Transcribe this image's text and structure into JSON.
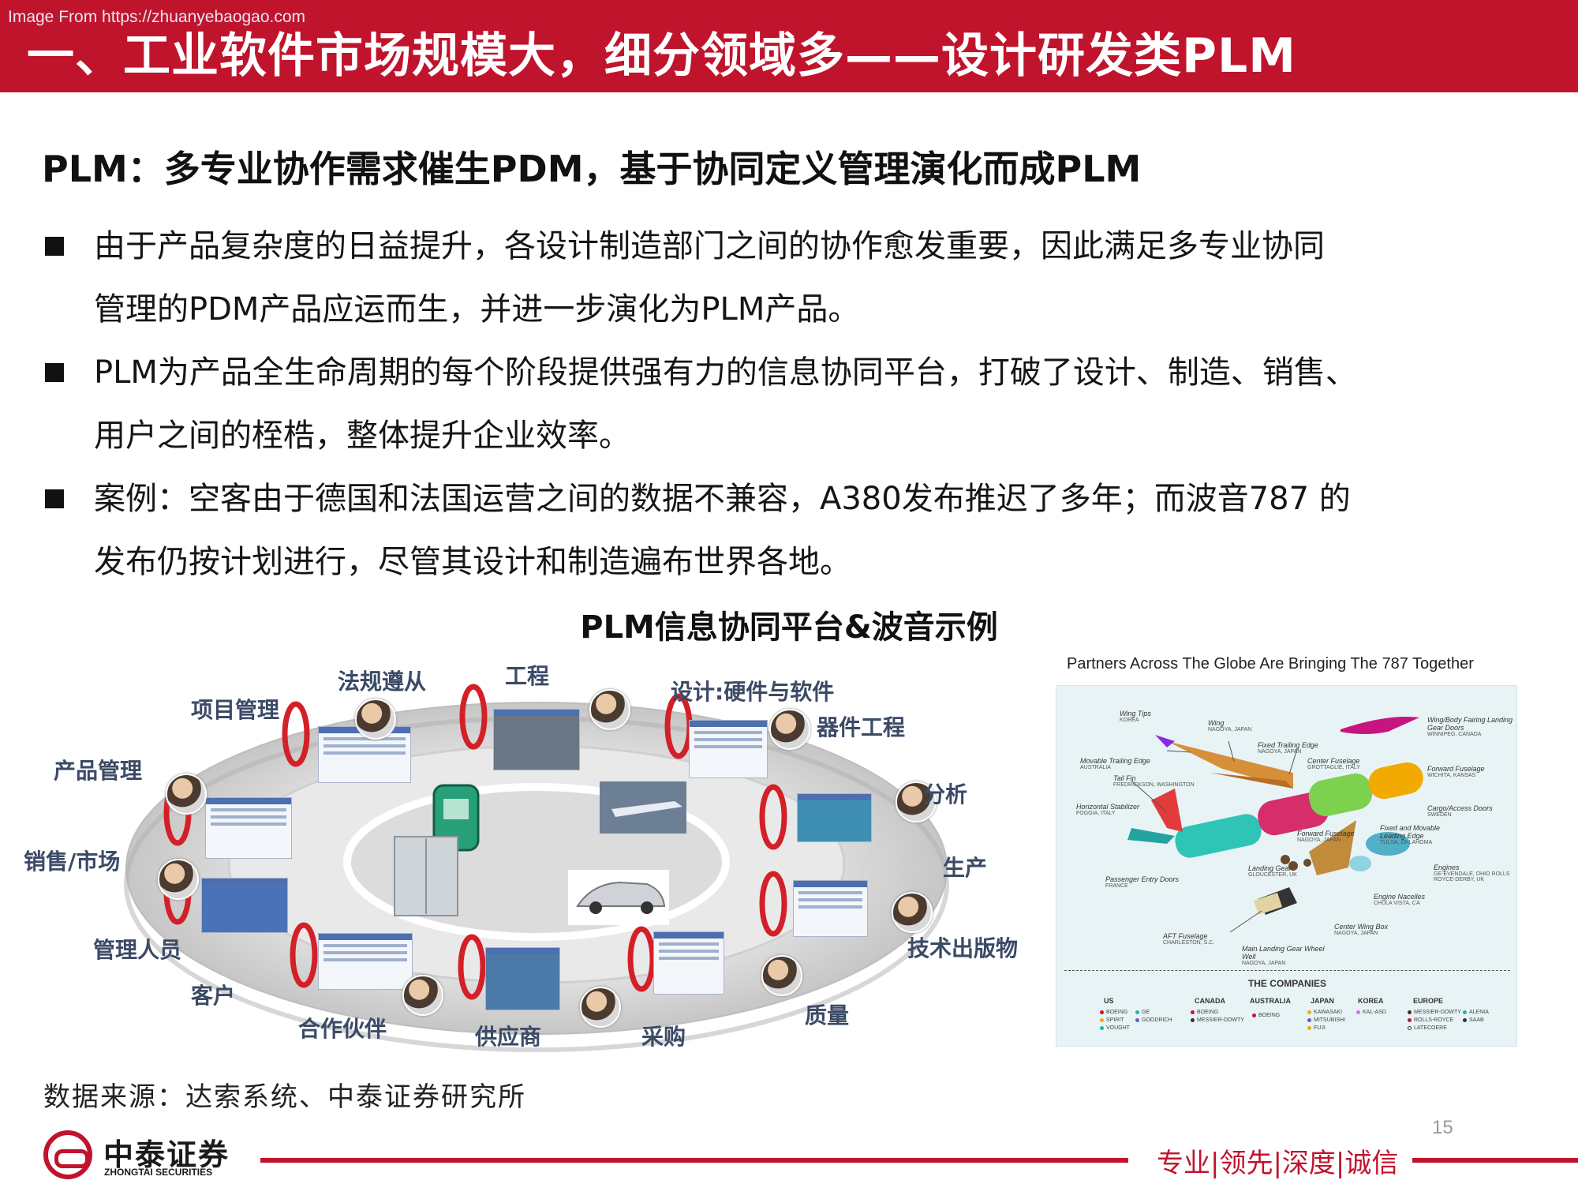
{
  "watermark": "Image From https://zhuanyebaogao.com",
  "title": "一、工业软件市场规模大，细分领域多——设计研发类PLM",
  "subtitle": "PLM：多专业协作需求催生PDM，基于协同定义管理演化而成PLM",
  "bullets": [
    {
      "line1": "由于产品复杂度的日益提升，各设计制造部门之间的协作愈发重要，因此满足多专业协同",
      "line2": "管理的PDM产品应运而生，并进一步演化为PLM产品。"
    },
    {
      "line1": "PLM为产品全生命周期的每个阶段提供强有力的信息协同平台，打破了设计、制造、销售、",
      "line2": "用户之间的桎梏，整体提升企业效率。"
    },
    {
      "line1": "案例：空客由于德国和法国运营之间的数据不兼容，A380发布推迟了多年；而波音787 的",
      "line2": "发布仍按计划进行，尽管其设计和制造遍布世界各地。"
    }
  ],
  "figure_caption": "PLM信息协同平台&波音示例",
  "plm_ring": {
    "labels": [
      "法规遵从",
      "工程",
      "设计:硬件与软件",
      "项目管理",
      "器件工程",
      "产品管理",
      "分析",
      "销售/市场",
      "生产",
      "管理人员",
      "技术出版物",
      "客户",
      "质量",
      "合作伙伴",
      "供应商",
      "采购"
    ]
  },
  "boeing": {
    "title": "Partners Across The Globe Are Bringing The 787 Together",
    "parts": [
      {
        "name": "Wing Tips",
        "place": "KOREA"
      },
      {
        "name": "Wing",
        "place": "NAGOYA, JAPAN"
      },
      {
        "name": "Wing/Body Fairing Landing Gear Doors",
        "place": "WINNIPEG, CANADA"
      },
      {
        "name": "Fixed Trailing Edge",
        "place": "NAGOYA, JAPAN"
      },
      {
        "name": "Movable Trailing Edge",
        "place": "AUSTRALIA"
      },
      {
        "name": "Center Fuselage",
        "place": "GROTTAGLIE, ITALY"
      },
      {
        "name": "Forward Fuselage",
        "place": "WICHITA, KANSAS"
      },
      {
        "name": "Tail Fin",
        "place": "FREDRICKSON, WASHINGTON"
      },
      {
        "name": "Cargo/Access Doors",
        "place": "SWEDEN"
      },
      {
        "name": "Horizontal Stabilizer",
        "place": "FOGGIA, ITALY"
      },
      {
        "name": "Fixed and Movable Leading Edge",
        "place": "TULSA, OKLAHOMA"
      },
      {
        "name": "Forward Fuselage",
        "place": "NAGOYA, JAPAN"
      },
      {
        "name": "Passenger Entry Doors",
        "place": "FRANCE"
      },
      {
        "name": "Landing Gear",
        "place": "GLOUCESTER, UK"
      },
      {
        "name": "Engines",
        "place": "GE-EVENDALE, OHIO ROLLS ROYCE-DERBY, UK"
      },
      {
        "name": "Engine Nacelles",
        "place": "CHULA VISTA, CA"
      },
      {
        "name": "Center Wing Box",
        "place": "NAGOYA, JAPAN"
      },
      {
        "name": "AFT Fuselage",
        "place": "CHARLESTON, S.C."
      },
      {
        "name": "Main Landing Gear Wheel Well",
        "place": "NAGOYA, JAPAN"
      }
    ],
    "companies_title": "THE COMPANIES",
    "countries": [
      "US",
      "CANADA",
      "AUSTRALIA",
      "JAPAN",
      "KOREA",
      "EUROPE"
    ],
    "companies": {
      "us": [
        "BOEING",
        "GE",
        "SPIRIT",
        "GOODRICH",
        "VOUGHT"
      ],
      "canada": [
        "BOEING",
        "MESSIER-DOWTY"
      ],
      "australia": [
        "BOEING"
      ],
      "japan": [
        "KAWASAKI",
        "MITSUBISHI",
        "FUJI"
      ],
      "korea": [
        "KAL-ASD"
      ],
      "europe": [
        "MESSIER-DOWTY",
        "ALENIA",
        "ROLLS-ROYCE",
        "SAAB",
        "LATECOERE"
      ]
    },
    "company_colors": [
      "#c8102e",
      "#f2a900",
      "#6a5acd",
      "#20b2aa",
      "#e066ff",
      "#333333"
    ]
  },
  "source": "数据来源：达索系统、中泰证券研究所",
  "page_number": "15",
  "logo": {
    "name": "中泰证券",
    "en": "ZHONGTAI SECURITIES"
  },
  "slogan": "专业|领先|深度|诚信",
  "colors": {
    "brand_red": "#c0142d"
  }
}
